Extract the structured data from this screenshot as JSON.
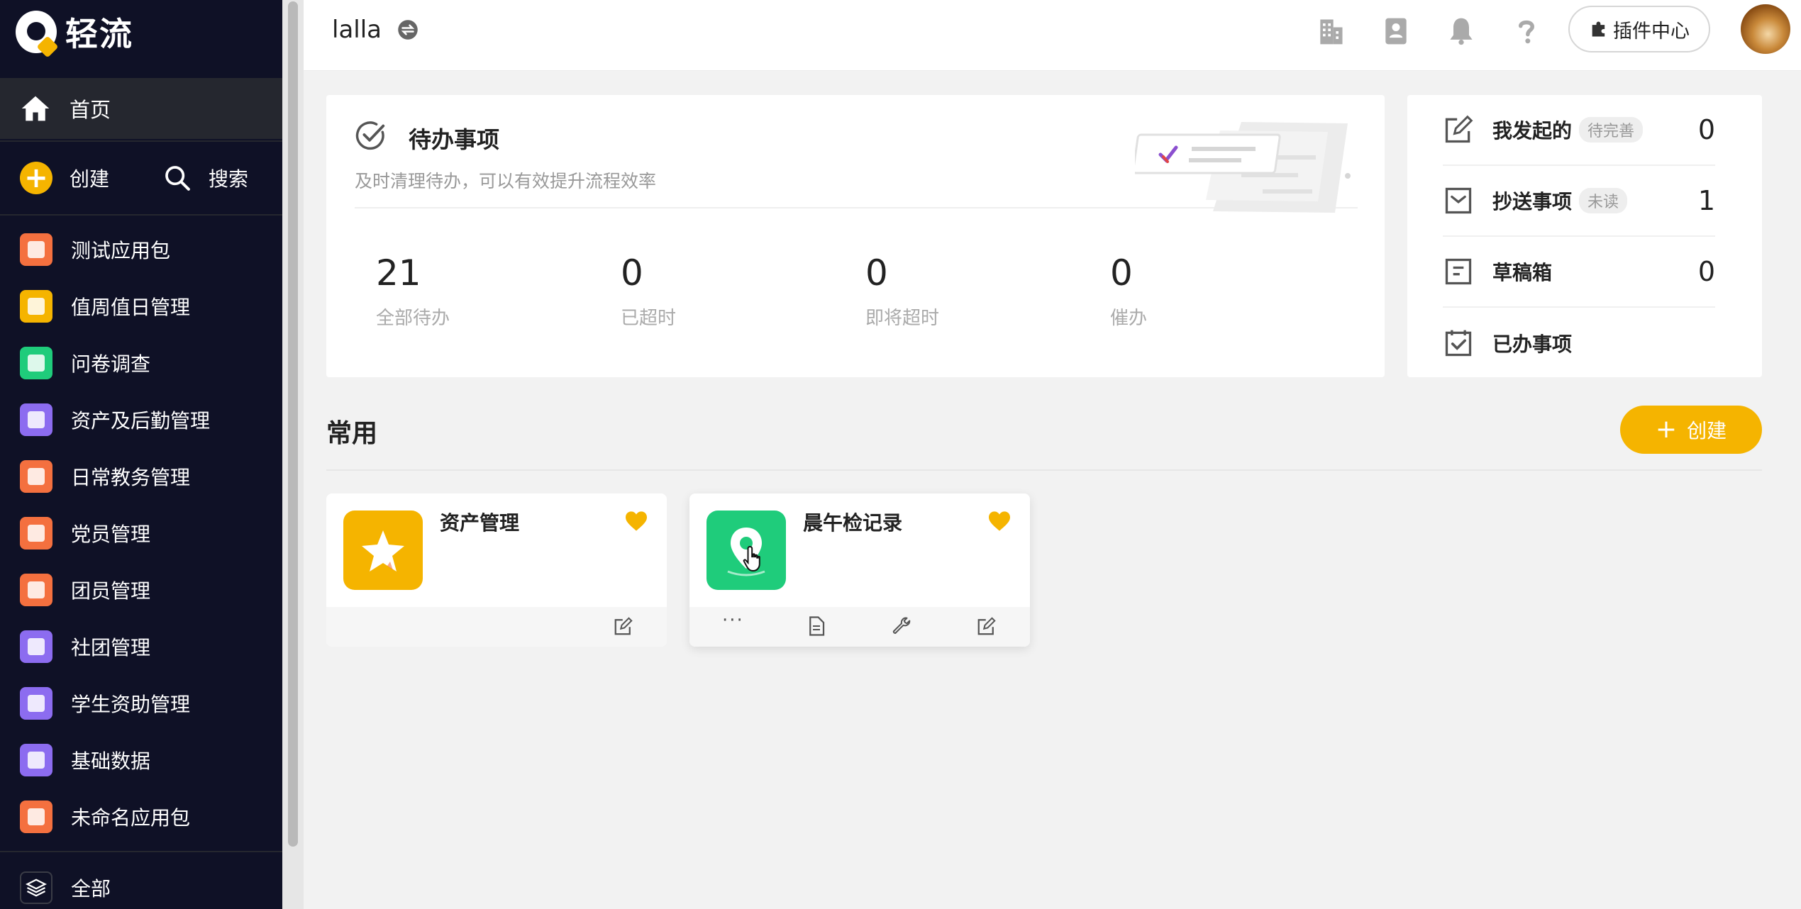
{
  "brand": {
    "name": "轻流"
  },
  "sidebar": {
    "home_label": "首页",
    "create_label": "创建",
    "search_label": "搜索",
    "apps": [
      {
        "label": "测试应用包",
        "color": "#f4703f"
      },
      {
        "label": "值周值日管理",
        "color": "#f5b400"
      },
      {
        "label": "问卷调查",
        "color": "#1fcc7b"
      },
      {
        "label": "资产及后勤管理",
        "color": "#8c6cf0"
      },
      {
        "label": "日常教务管理",
        "color": "#f4703f"
      },
      {
        "label": "党员管理",
        "color": "#f4703f"
      },
      {
        "label": "团员管理",
        "color": "#f4703f"
      },
      {
        "label": "社团管理",
        "color": "#8c6cf0"
      },
      {
        "label": "学生资助管理",
        "color": "#8c6cf0"
      },
      {
        "label": "基础数据",
        "color": "#8c6cf0"
      },
      {
        "label": "未命名应用包",
        "color": "#f4703f"
      }
    ],
    "all_label": "全部"
  },
  "header": {
    "org_name": "lalla",
    "plugin_label": "插件中心"
  },
  "todo": {
    "title": "待办事项",
    "subtitle": "及时清理待办，可以有效提升流程效率",
    "stats": [
      {
        "value": "21",
        "label": "全部待办"
      },
      {
        "value": "0",
        "label": "已超时"
      },
      {
        "value": "0",
        "label": "即将超时"
      },
      {
        "value": "0",
        "label": "催办"
      }
    ]
  },
  "side_list": [
    {
      "label": "我发起的",
      "tag": "待完善",
      "count": "0"
    },
    {
      "label": "抄送事项",
      "tag": "未读",
      "count": "1"
    },
    {
      "label": "草稿箱",
      "tag": "",
      "count": "0"
    },
    {
      "label": "已办事项",
      "tag": "",
      "count": ""
    }
  ],
  "frequent": {
    "title": "常用",
    "create_label": "创建",
    "apps": [
      {
        "title": "资产管理",
        "color": "#f5b400"
      },
      {
        "title": "晨午检记录",
        "color": "#1fcc7b"
      }
    ]
  },
  "colors": {
    "accent": "#f5b400",
    "sidebar_bg": "#0f1126"
  }
}
